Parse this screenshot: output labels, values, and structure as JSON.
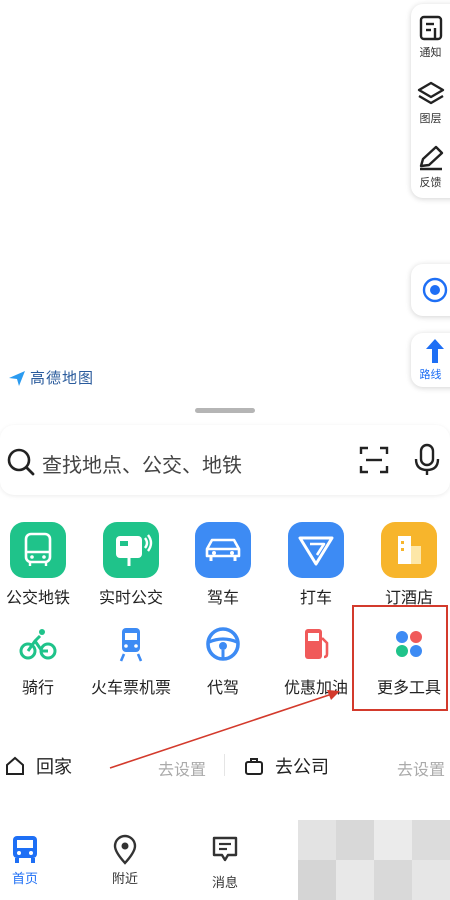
{
  "map": {
    "logo_text": "高德地图",
    "side_tools": [
      {
        "label": "通知",
        "icon": "notice-icon"
      },
      {
        "label": "图层",
        "icon": "layers-icon"
      },
      {
        "label": "反馈",
        "icon": "feedback-pen-icon"
      }
    ],
    "locate_icon": "locate-icon",
    "route_label": "路线"
  },
  "search": {
    "placeholder": "查找地点、公交、地铁"
  },
  "services_row1": [
    {
      "label": "公交地铁",
      "icon": "bus-metro-icon",
      "color": "#1fc38a"
    },
    {
      "label": "实时公交",
      "icon": "realtime-bus-icon",
      "color": "#1fc38a"
    },
    {
      "label": "驾车",
      "icon": "car-icon",
      "color": "#3d8bf4"
    },
    {
      "label": "打车",
      "icon": "taxi-icon",
      "color": "#3d8bf4"
    },
    {
      "label": "订酒店",
      "icon": "hotel-icon",
      "color": "#f7b52c"
    }
  ],
  "services_row2": [
    {
      "label": "骑行",
      "icon": "bike-icon",
      "color": "#1fc38a"
    },
    {
      "label": "火车票机票",
      "icon": "train-icon",
      "color": "#3d8bf4"
    },
    {
      "label": "代驾",
      "icon": "steering-wheel-icon",
      "color": "#3d8bf4"
    },
    {
      "label": "优惠加油",
      "icon": "fuel-icon",
      "color": "#f05a5a"
    },
    {
      "label": "更多工具",
      "icon": "more-tools-icon",
      "color": "#3d8bf4"
    }
  ],
  "shortcuts": [
    {
      "label": "回家",
      "action": "去设置",
      "icon": "home-icon"
    },
    {
      "label": "去公司",
      "action": "去设置",
      "icon": "briefcase-icon"
    }
  ],
  "tabs": [
    {
      "label": "首页",
      "icon": "bus-tab-icon",
      "active": true
    },
    {
      "label": "附近",
      "icon": "pin-icon",
      "active": false
    },
    {
      "label": "消息",
      "icon": "message-icon",
      "active": false
    }
  ],
  "colors": {
    "accent": "#1e6ff5",
    "highlight": "#d33a2c"
  }
}
